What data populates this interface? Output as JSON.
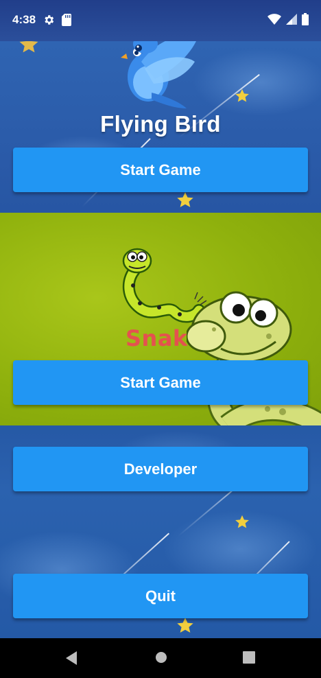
{
  "status_bar": {
    "time": "4:38",
    "left_icons": [
      "gear-icon",
      "sd-card-icon"
    ],
    "right_icons": [
      "wifi-icon",
      "signal-icon",
      "battery-icon"
    ]
  },
  "app": {
    "title": "Flying Bird",
    "snake_title": "Snake"
  },
  "buttons": {
    "start_flying": "Start Game",
    "start_snake": "Start Game",
    "developer": "Developer",
    "quit": "Quit"
  },
  "nav_bar": {
    "items": [
      "back-icon",
      "home-icon",
      "recents-icon"
    ]
  },
  "colors": {
    "button": "#2196f3",
    "sky": "#2a5aa8",
    "snake_banner": "#8fb10d",
    "snake_text": "#e4524f"
  }
}
